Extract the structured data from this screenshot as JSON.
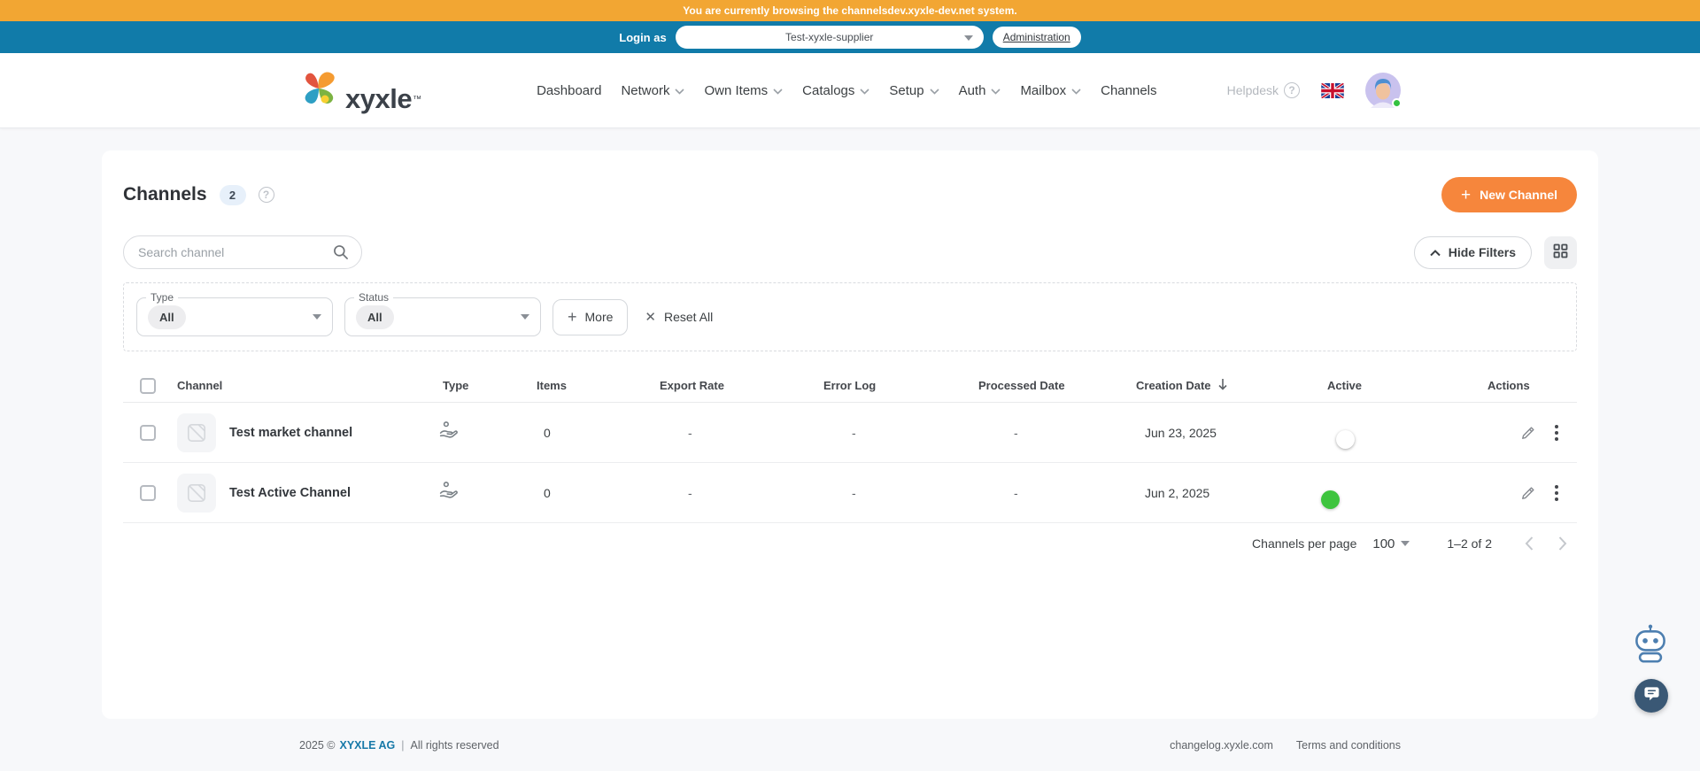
{
  "banner": {
    "text": "You are currently browsing the channelsdev.xyxle-dev.net system."
  },
  "login_bar": {
    "label": "Login as",
    "select_value": "Test-xyxle-supplier",
    "admin_label": "Administration"
  },
  "header": {
    "logo_text": "xyxle",
    "logo_tm": "™",
    "nav": [
      {
        "label": "Dashboard",
        "dropdown": false
      },
      {
        "label": "Network",
        "dropdown": true
      },
      {
        "label": "Own Items",
        "dropdown": true
      },
      {
        "label": "Catalogs",
        "dropdown": true
      },
      {
        "label": "Setup",
        "dropdown": true
      },
      {
        "label": "Auth",
        "dropdown": true
      },
      {
        "label": "Mailbox",
        "dropdown": true
      },
      {
        "label": "Channels",
        "dropdown": false
      }
    ],
    "helpdesk_label": "Helpdesk"
  },
  "page": {
    "title": "Channels",
    "count_badge": "2",
    "new_channel_label": "New Channel",
    "search_placeholder": "Search channel",
    "hide_filters_label": "Hide Filters",
    "filters": {
      "type_label": "Type",
      "type_value": "All",
      "status_label": "Status",
      "status_value": "All",
      "more_label": "More",
      "reset_label": "Reset All"
    },
    "table": {
      "headers": {
        "channel": "Channel",
        "type": "Type",
        "items": "Items",
        "export_rate": "Export Rate",
        "error_log": "Error Log",
        "processed_date": "Processed Date",
        "creation_date": "Creation Date",
        "active": "Active",
        "actions": "Actions"
      },
      "rows": [
        {
          "name": "Test market channel",
          "items": "0",
          "export_rate": "-",
          "error_log": "-",
          "processed_date": "-",
          "creation_date": "Jun 23, 2025",
          "active": false
        },
        {
          "name": "Test Active Channel",
          "items": "0",
          "export_rate": "-",
          "error_log": "-",
          "processed_date": "-",
          "creation_date": "Jun 2, 2025",
          "active": true
        }
      ]
    },
    "pagination": {
      "per_page_label": "Channels per page",
      "per_page_value": "100",
      "range_label": "1–2 of 2"
    }
  },
  "footer": {
    "year": "2025 ©",
    "company": "XYXLE AG",
    "separator": "|",
    "rights": "All rights reserved",
    "changelog": "changelog.xyxle.com",
    "terms": "Terms and conditions"
  },
  "icons": {
    "search": "magnifier",
    "help": "question-mark-circle",
    "language": "uk-flag",
    "type_column": "hand-coin",
    "thumbnail": "no-image",
    "sort": "arrow-down",
    "edit": "pencil",
    "row_menu": "kebab-vertical",
    "chat": "robot-and-messenger"
  },
  "colors": {
    "banner_orange": "#F2A633",
    "topbar_blue": "#117BA9",
    "accent_orange": "#F6863C",
    "toggle_on_green": "#3EC43E",
    "link_blue": "#1779A8",
    "badge_bg": "#E7F0FA"
  }
}
